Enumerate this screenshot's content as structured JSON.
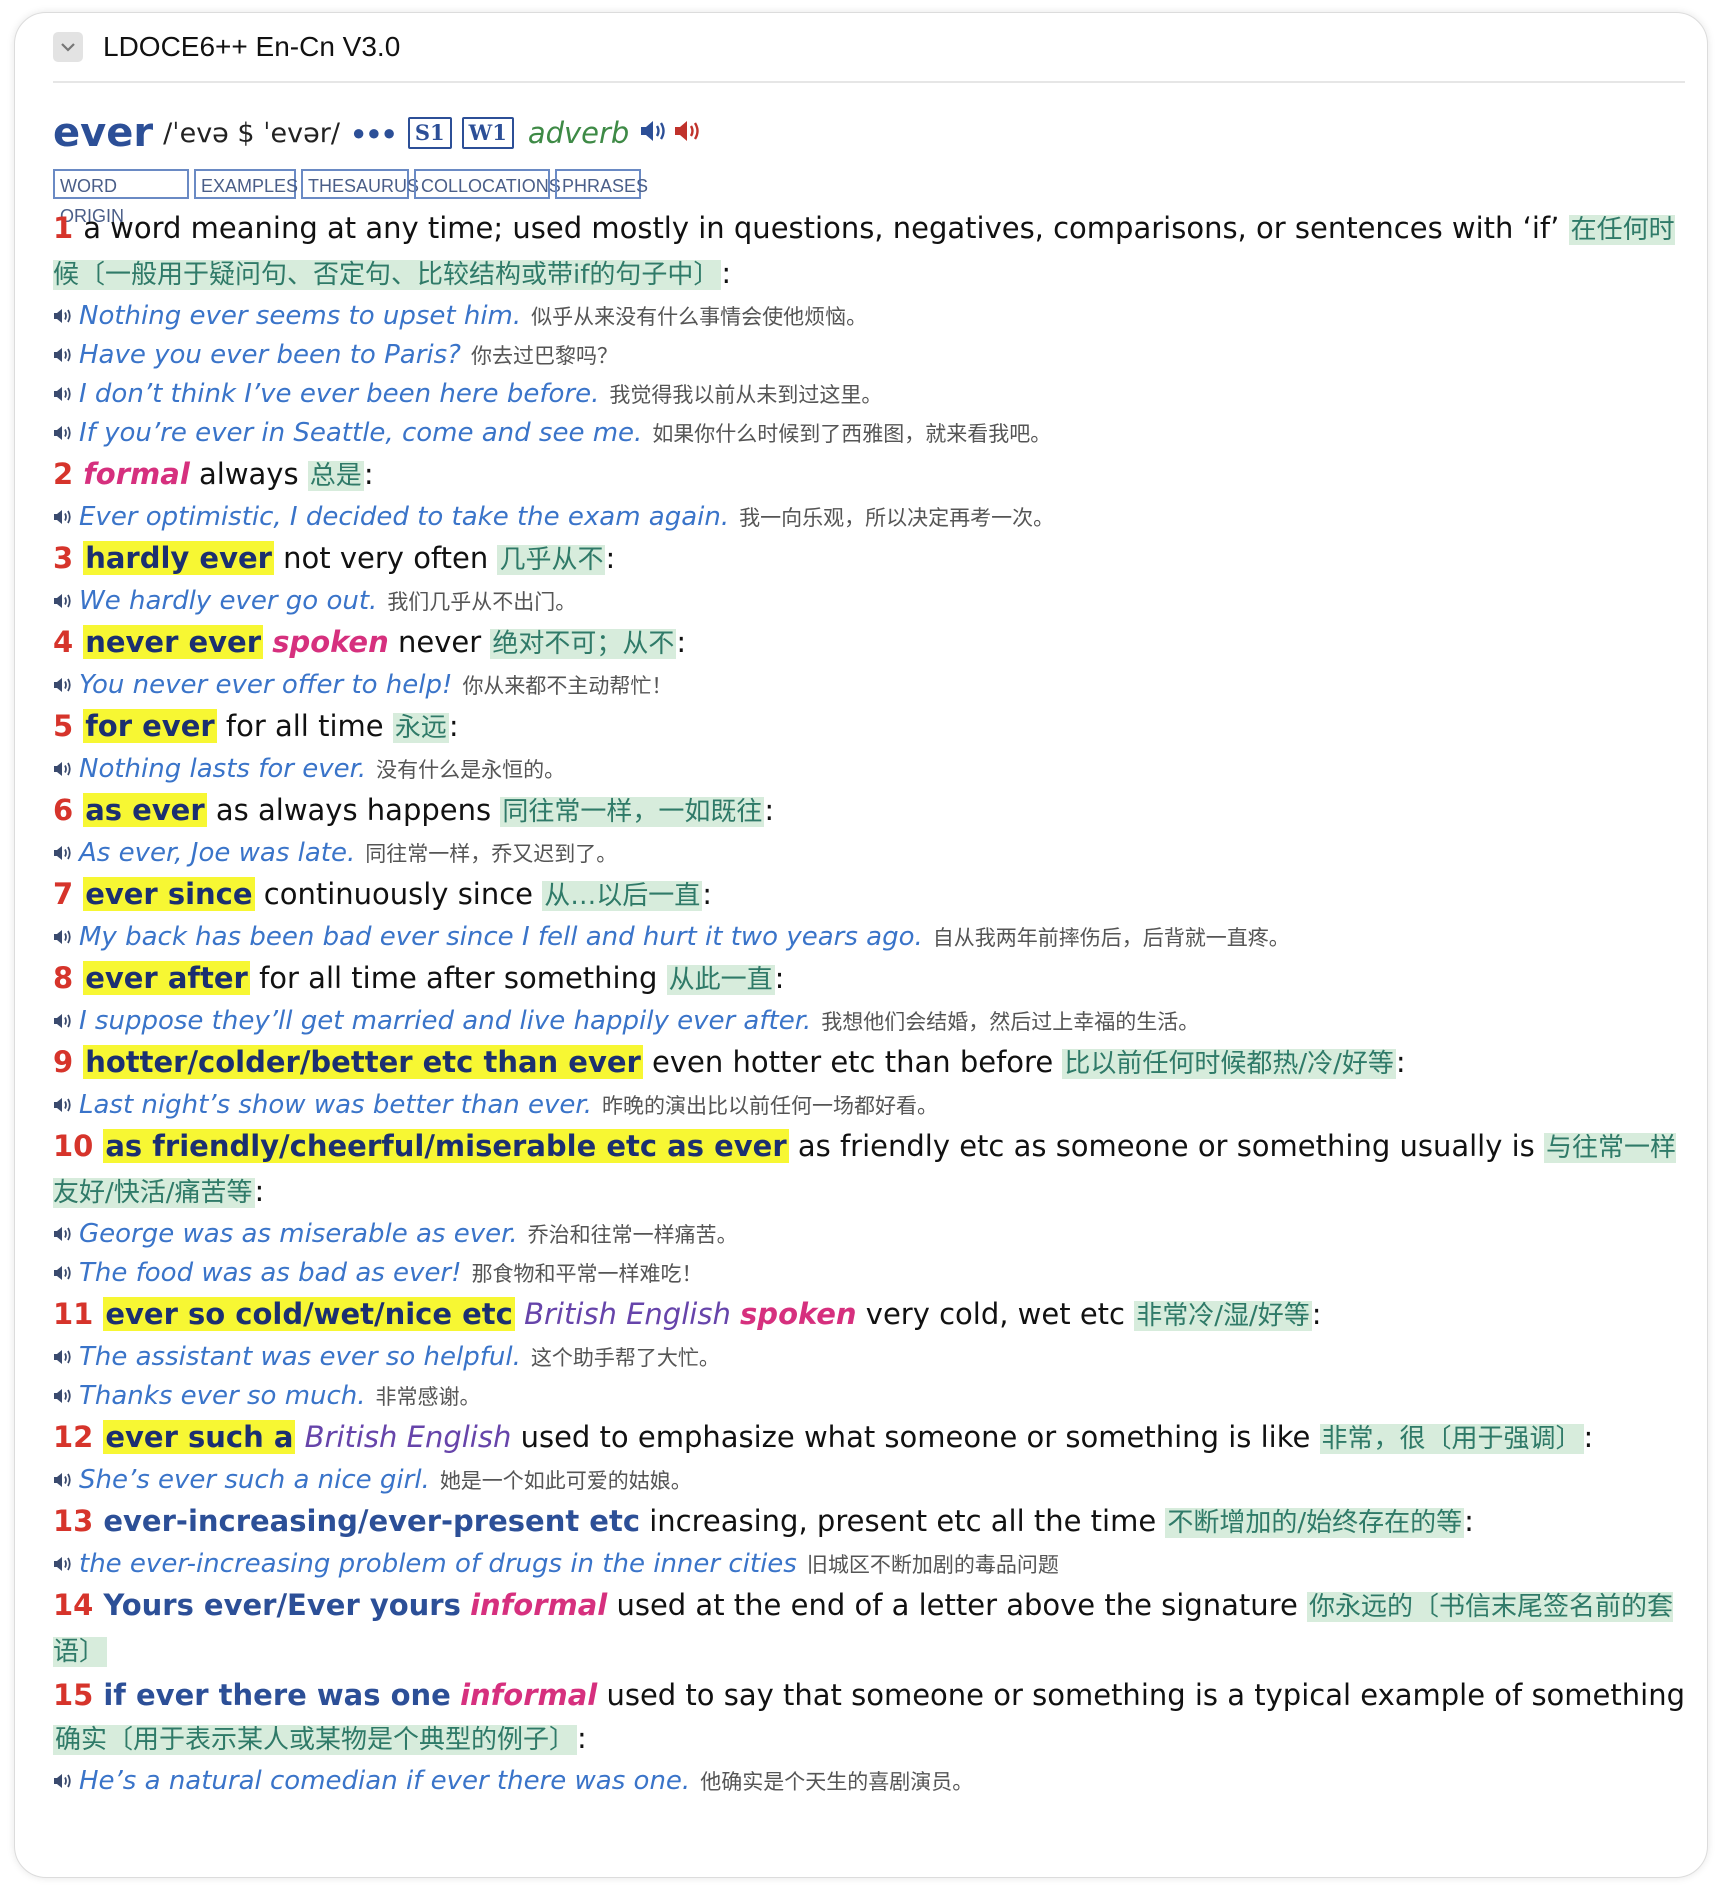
{
  "app": {
    "dict_title": "LDOCE6++ En-Cn V3.0"
  },
  "entry": {
    "headword": "ever",
    "pron": "/ˈevə $ ˈevər/",
    "freq_dots": "●●●",
    "freq_s": "S1",
    "freq_w": "W1",
    "pos": "adverb"
  },
  "tabs": [
    "WORD ORIGIN",
    "EXAMPLES",
    "THESAURUS",
    "COLLOCATIONS",
    "PHRASES"
  ],
  "senses": [
    {
      "num": "1",
      "phrase": "",
      "phrase_style": "",
      "labels": [],
      "def": "a word meaning at any time; used mostly in questions, negatives, comparisons, or sentences with ‘if’",
      "zh": "在任何时候〔一般用于疑问句、否定句、比较结构或带if的句子中〕",
      "colon": ":",
      "examples": [
        {
          "en": "Nothing ever seems to upset him.",
          "zh": "似乎从来没有什么事情会使他烦恼。"
        },
        {
          "en": "Have you ever been to Paris?",
          "zh": "你去过巴黎吗？"
        },
        {
          "en": "I don’t think I’ve ever been here before.",
          "zh": "我觉得我以前从未到过这里。"
        },
        {
          "en": "If you’re ever in Seattle, come and see me.",
          "zh": "如果你什么时候到了西雅图，就来看我吧。"
        }
      ]
    },
    {
      "num": "2",
      "phrase": "",
      "phrase_style": "",
      "labels": [
        {
          "text": "formal",
          "type": "reg"
        }
      ],
      "def": "always",
      "zh": "总是",
      "colon": ":",
      "examples": [
        {
          "en": "Ever optimistic, I decided to take the exam again.",
          "zh": "我一向乐观，所以决定再考一次。"
        }
      ]
    },
    {
      "num": "3",
      "phrase": "hardly ever",
      "phrase_style": "hl",
      "labels": [],
      "def": "not very often",
      "zh": "几乎从不",
      "colon": ":",
      "examples": [
        {
          "en": "We hardly ever go out.",
          "zh": "我们几乎从不出门。"
        }
      ]
    },
    {
      "num": "4",
      "phrase": "never ever",
      "phrase_style": "hl",
      "labels": [
        {
          "text": "spoken",
          "type": "reg"
        }
      ],
      "def": "never",
      "zh": "绝对不可；从不",
      "colon": ":",
      "examples": [
        {
          "en": "You never ever offer to help!",
          "zh": "你从来都不主动帮忙！"
        }
      ]
    },
    {
      "num": "5",
      "phrase": "for ever",
      "phrase_style": "hl",
      "labels": [],
      "def": "for all time",
      "zh": "永远",
      "colon": ":",
      "examples": [
        {
          "en": "Nothing lasts for ever.",
          "zh": "没有什么是永恒的。"
        }
      ]
    },
    {
      "num": "6",
      "phrase": "as ever",
      "phrase_style": "hl",
      "labels": [],
      "def": "as always happens",
      "zh": "同往常一样，一如既往",
      "colon": ":",
      "examples": [
        {
          "en": "As ever, Joe was late.",
          "zh": "同往常一样，乔又迟到了。"
        }
      ]
    },
    {
      "num": "7",
      "phrase": "ever since",
      "phrase_style": "hl",
      "labels": [],
      "def": "continuously since",
      "zh": "从…以后一直",
      "colon": ":",
      "examples": [
        {
          "en": "My back has been bad ever since I fell and hurt it two years ago.",
          "zh": "自从我两年前摔伤后，后背就一直疼。"
        }
      ]
    },
    {
      "num": "8",
      "phrase": "ever after",
      "phrase_style": "hl",
      "labels": [],
      "def": "for all time after something",
      "zh": "从此一直",
      "colon": ":",
      "examples": [
        {
          "en": "I suppose they’ll get married and live happily ever after.",
          "zh": "我想他们会结婚，然后过上幸福的生活。"
        }
      ]
    },
    {
      "num": "9",
      "phrase": "hotter/colder/better etc than ever",
      "phrase_style": "hl",
      "labels": [],
      "def": "even hotter etc than before",
      "zh": "比以前任何时候都热/冷/好等",
      "colon": ":",
      "examples": [
        {
          "en": "Last night’s show was better than ever.",
          "zh": "昨晚的演出比以前任何一场都好看。"
        }
      ]
    },
    {
      "num": "10",
      "phrase": "as friendly/cheerful/miserable etc as ever",
      "phrase_style": "hl",
      "labels": [],
      "def": "as friendly etc as someone or something usually is",
      "zh": "与往常一样友好/快活/痛苦等",
      "colon": ":",
      "examples": [
        {
          "en": "George was as miserable as ever.",
          "zh": "乔治和往常一样痛苦。"
        },
        {
          "en": "The food was as bad as ever!",
          "zh": "那食物和平常一样难吃！"
        }
      ]
    },
    {
      "num": "11",
      "phrase": "ever so cold/wet/nice etc",
      "phrase_style": "hl",
      "labels": [
        {
          "text": "British English",
          "type": "geo"
        },
        {
          "text": "spoken",
          "type": "reg"
        }
      ],
      "def": "very cold, wet etc",
      "zh": "非常冷/湿/好等",
      "colon": ":",
      "examples": [
        {
          "en": "The assistant was ever so helpful.",
          "zh": "这个助手帮了大忙。"
        },
        {
          "en": "Thanks ever so much.",
          "zh": "非常感谢。"
        }
      ]
    },
    {
      "num": "12",
      "phrase": "ever such a",
      "phrase_style": "hl",
      "labels": [
        {
          "text": "British English",
          "type": "geo"
        }
      ],
      "def": "used to emphasize what someone or something is like",
      "zh": "非常，很〔用于强调〕",
      "colon": ":",
      "examples": [
        {
          "en": "She’s ever such a nice girl.",
          "zh": "她是一个如此可爱的姑娘。"
        }
      ]
    },
    {
      "num": "13",
      "phrase": "ever-increasing/ever-present etc",
      "phrase_style": "blue",
      "labels": [],
      "def": "increasing, present etc all the time",
      "zh": "不断增加的/始终存在的等",
      "colon": ":",
      "examples": [
        {
          "en": "the ever-increasing problem of drugs in the inner cities",
          "zh": "旧城区不断加剧的毒品问题"
        }
      ]
    },
    {
      "num": "14",
      "phrase": "Yours ever/Ever yours",
      "phrase_style": "blue",
      "labels": [
        {
          "text": "informal",
          "type": "reg"
        }
      ],
      "def": "used at the end of a letter above the signature",
      "zh": "你永远的〔书信末尾签名前的套语〕",
      "colon": "",
      "examples": []
    },
    {
      "num": "15",
      "phrase": "if ever there was one",
      "phrase_style": "blue",
      "labels": [
        {
          "text": "informal",
          "type": "reg"
        }
      ],
      "def": "used to say that someone or something is a typical example of something",
      "zh": "确实〔用于表示某人或某物是个典型的例子〕",
      "colon": ":",
      "examples": [
        {
          "en": "He’s a natural comedian if ever there was one.",
          "zh": "他确实是个天生的喜剧演员。"
        }
      ]
    }
  ]
}
